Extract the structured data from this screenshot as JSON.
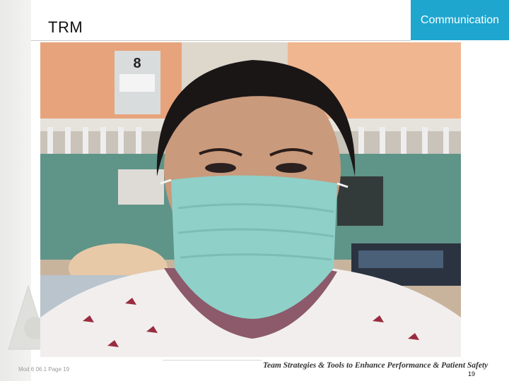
{
  "slide": {
    "title": "TRM",
    "section_tab": "Communication",
    "footer_left": "Mod 6 06.1  Page 19",
    "footer_title": "Team Strategies & Tools to Enhance Performance & Patient Safety",
    "page_number": "19"
  },
  "photo": {
    "bed_number": "8",
    "description_icon": "photo"
  },
  "colors": {
    "accent": "#1ea6cf",
    "mask": "#8fd0c9",
    "wall": "#5f9488"
  }
}
